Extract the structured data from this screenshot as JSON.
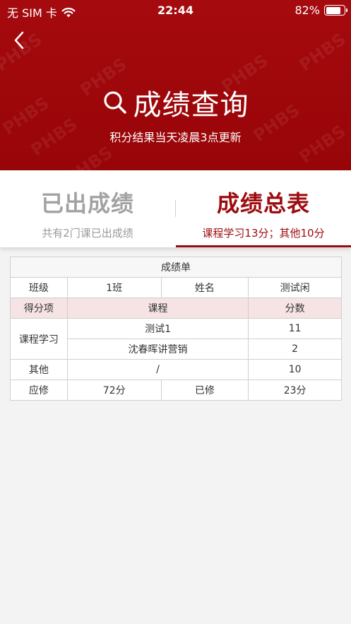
{
  "status_bar": {
    "carrier": "无 SIM 卡",
    "time": "22:44",
    "battery": "82%"
  },
  "header": {
    "title": "成绩查询",
    "subtitle": "积分结果当天凌晨3点更新",
    "watermark": "PHBS",
    "bg_color": "#a0080c"
  },
  "tabs": [
    {
      "title": "已出成绩",
      "sub": "共有2门课已出成绩",
      "active": false
    },
    {
      "title": "成绩总表",
      "sub": "课程学习13分；其他10分",
      "active": true
    }
  ],
  "table": {
    "caption": "成绩单",
    "class_label": "班级",
    "class_value": "1班",
    "name_label": "姓名",
    "name_value": "测试闲",
    "header": {
      "item": "得分项",
      "course": "课程",
      "score": "分数"
    },
    "course_group": "课程学习",
    "courses": [
      {
        "name": "测试1",
        "score": "11"
      },
      {
        "name": "沈春晖讲营销",
        "score": "2"
      }
    ],
    "other": {
      "label": "其他",
      "course": "/",
      "score": "10"
    },
    "summary": {
      "required_label": "应修",
      "required_value": "72分",
      "done_label": "已修",
      "done_value": "23分"
    }
  },
  "colors": {
    "accent": "#9d0b0f",
    "highlight_row": "#f6e3e3"
  }
}
